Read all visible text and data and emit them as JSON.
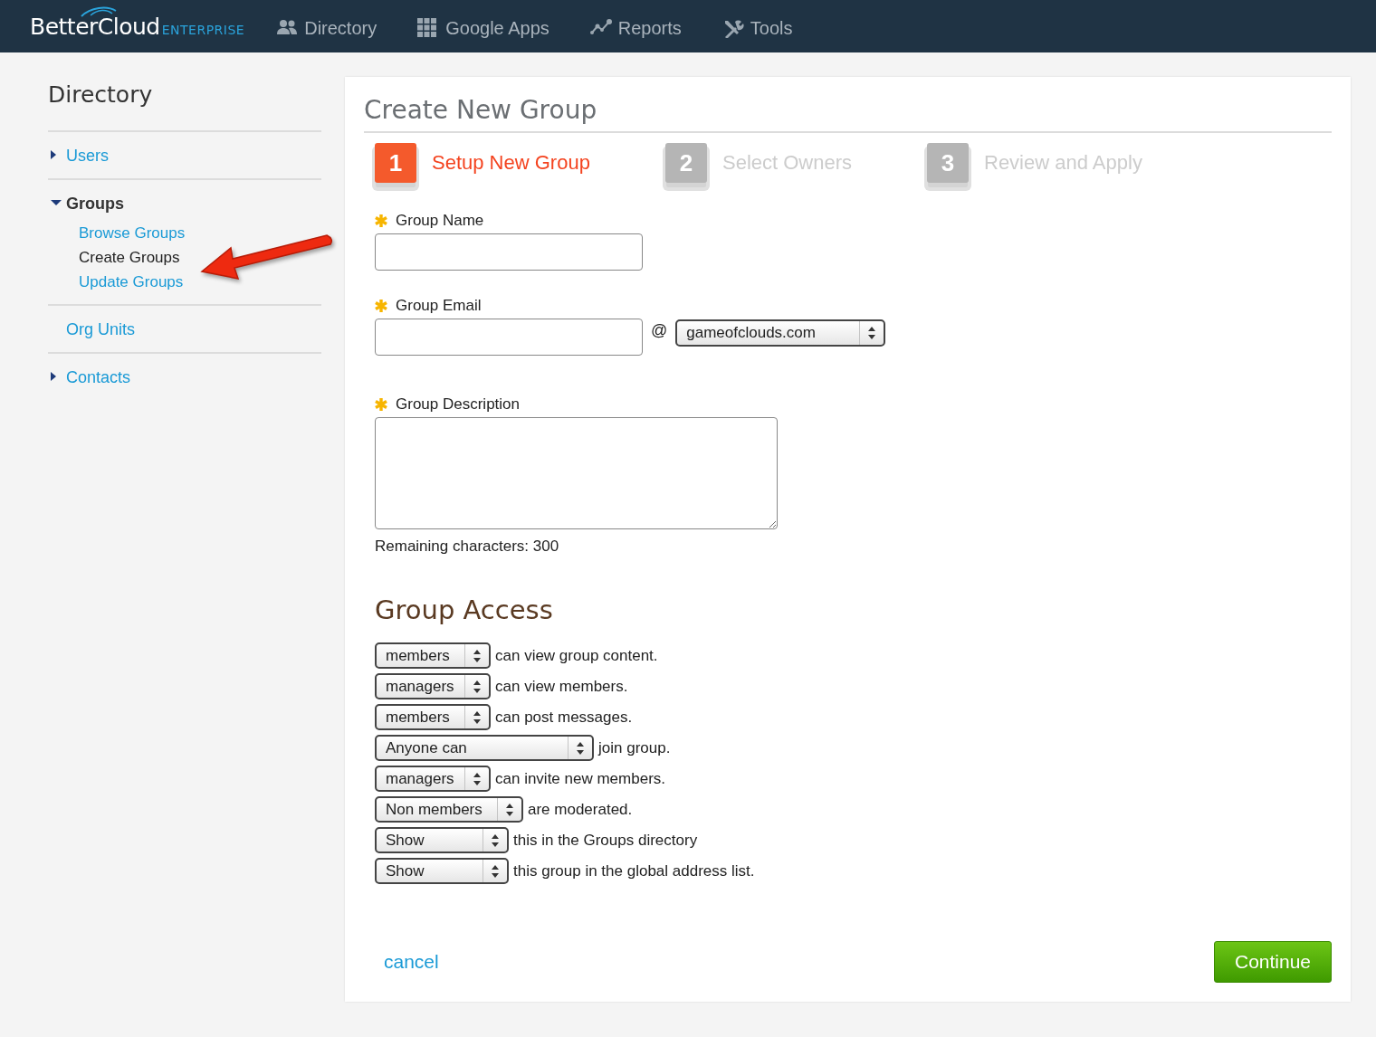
{
  "header": {
    "logo": "BetterCloud",
    "edition": "ENTERPRISE",
    "nav": [
      {
        "label": "Directory"
      },
      {
        "label": "Google Apps"
      },
      {
        "label": "Reports"
      },
      {
        "label": "Tools"
      }
    ]
  },
  "sidebar": {
    "title": "Directory",
    "items": [
      {
        "label": "Users",
        "kind": "folder",
        "expanded": false
      },
      {
        "label": "Groups",
        "kind": "folder",
        "expanded": true,
        "children": [
          {
            "label": "Browse Groups",
            "selected": false
          },
          {
            "label": "Create Groups",
            "selected": true
          },
          {
            "label": "Update Groups",
            "selected": false
          }
        ]
      },
      {
        "label": "Org Units",
        "kind": "link"
      },
      {
        "label": "Contacts",
        "kind": "folder",
        "expanded": false
      }
    ]
  },
  "form": {
    "title": "Create New Group",
    "steps": [
      {
        "number": "1",
        "label": "Setup New Group",
        "selected": true
      },
      {
        "number": "2",
        "label": "Select Owners",
        "selected": false
      },
      {
        "number": "3",
        "label": "Review and Apply",
        "selected": false
      }
    ],
    "fields": [
      {
        "kind": "text",
        "label": "Group Name",
        "required": true
      },
      {
        "kind": "email",
        "label": "Group Email",
        "required": true,
        "at": "@",
        "domain": "gameofclouds.com"
      },
      {
        "kind": "textarea",
        "label": "Group Description",
        "required": true,
        "remaining": "Remaining characters: 300"
      }
    ],
    "access": {
      "title": "Group Access",
      "rules": [
        {
          "value": "members",
          "text": "can view group content."
        },
        {
          "value": "managers",
          "text": "can view members."
        },
        {
          "value": "members",
          "text": "can post messages."
        },
        {
          "value": "Anyone can",
          "text": "join group."
        },
        {
          "value": "managers",
          "text": "can invite new members."
        },
        {
          "value": "Non members",
          "text": "are moderated."
        },
        {
          "value": "Show",
          "text": "this in the Groups directory"
        },
        {
          "value": "Show",
          "text": "this group in the global address list."
        }
      ]
    },
    "cancel": "cancel",
    "continue": "Continue"
  }
}
